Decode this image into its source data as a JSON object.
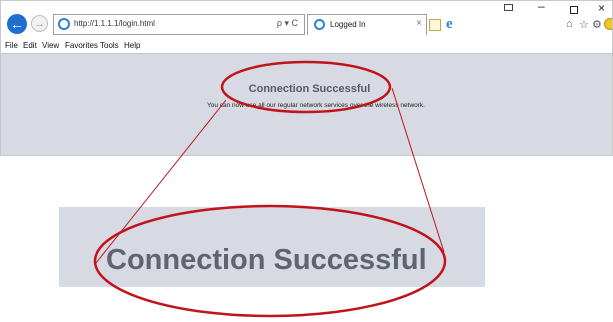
{
  "browser": {
    "url": "http://1.1.1.1/login.html",
    "address_controls": "ρ ▾ C",
    "tab_title": "Logged In",
    "tab_close": "×",
    "ie_logo": "e",
    "back_glyph": "←",
    "forward_glyph": "→",
    "window_minimize": "–",
    "window_close": "×",
    "toolbar_icons": [
      "home-icon",
      "star-icon",
      "gear-icon",
      "smile-icon"
    ],
    "home_glyph": "⌂",
    "star_glyph": "☆",
    "gear_glyph": "⚙"
  },
  "menu": [
    "File",
    "Edit",
    "View",
    "Favorites",
    "Tools",
    "Help"
  ],
  "page": {
    "heading": "Connection Successful",
    "message": "You can now use all our regular network services over the wireless network."
  },
  "zoom": {
    "heading": "Connection Successful"
  },
  "colors": {
    "content_bg": "#d7dae3",
    "heading_color": "#555a68",
    "annotation_red": "#c0141a",
    "ie_blue": "#2d7fe0"
  }
}
